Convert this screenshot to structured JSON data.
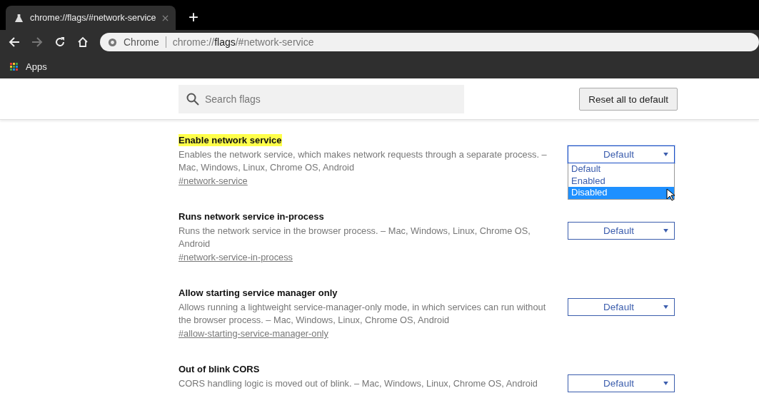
{
  "tab": {
    "title": "chrome://flags/#network-service",
    "new_tab": "+"
  },
  "omnibox": {
    "site_label": "Chrome",
    "url_scheme": "chrome://",
    "url_host": "flags",
    "url_path": "/#network-service"
  },
  "bookmarks": [
    {
      "label": "Apps"
    }
  ],
  "search": {
    "placeholder": "Search flags"
  },
  "reset_button": "Reset all to default",
  "flags": [
    {
      "title": "Enable network service",
      "highlighted": true,
      "description": "Enables the network service, which makes network requests through a separate process. – Mac, Windows, Linux, Chrome OS, Android",
      "anchor": "#network-service",
      "value": "Default",
      "expanded": true,
      "options": [
        {
          "label": "Default",
          "highlighted": false
        },
        {
          "label": "Enabled",
          "highlighted": false
        },
        {
          "label": "Disabled",
          "highlighted": true
        }
      ]
    },
    {
      "title": "Runs network service in-process",
      "highlighted": false,
      "description": "Runs the network service in the browser process. – Mac, Windows, Linux, Chrome OS, Android",
      "anchor": "#network-service-in-process",
      "value": "Default",
      "expanded": false
    },
    {
      "title": "Allow starting service manager only",
      "highlighted": false,
      "description": "Allows running a lightweight service-manager-only mode, in which services can run without the browser process. – Mac, Windows, Linux, Chrome OS, Android",
      "anchor": "#allow-starting-service-manager-only",
      "value": "Default",
      "expanded": false
    },
    {
      "title": "Out of blink CORS",
      "highlighted": false,
      "description": "CORS handling logic is moved out of blink. – Mac, Windows, Linux, Chrome OS, Android",
      "value": "Default",
      "expanded": false
    }
  ]
}
